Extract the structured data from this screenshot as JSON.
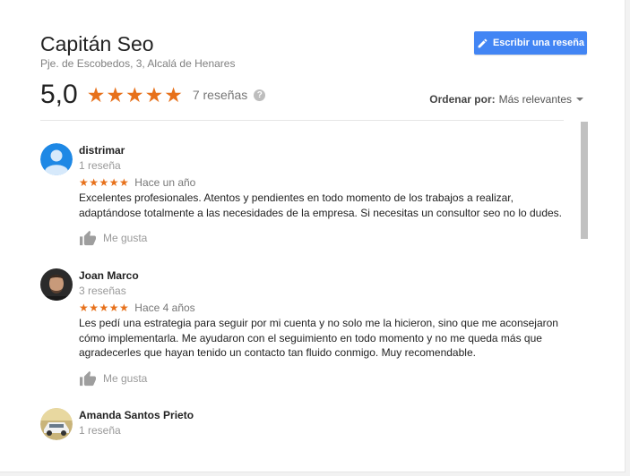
{
  "business": {
    "name": "Capitán Seo",
    "address": "Pje. de Escobedos, 3, Alcalá de Henares"
  },
  "write_review": {
    "label": "Escribir una reseña",
    "icon": "pencil-icon",
    "color": "#4285f4"
  },
  "summary": {
    "rating": "5,0",
    "stars": "★★★★★",
    "count_label": "7 reseñas",
    "help_icon": "?"
  },
  "sort": {
    "label": "Ordenar por:",
    "value": "Más relevantes"
  },
  "colors": {
    "star": "#e7711b",
    "accent": "#4285f4"
  },
  "reviews": [
    {
      "name": "distrimar",
      "meta": "1 reseña",
      "stars": "★★★★★",
      "rating": 5,
      "date": "Hace un año",
      "text": "Excelentes profesionales. Atentos y pendientes en todo momento de los trabajos a realizar, adaptándose totalmente a las necesidades de la empresa. Si necesitas un consultor seo no lo dudes.",
      "like_label": "Me gusta"
    },
    {
      "name": "Joan Marco",
      "meta": "3 reseñas",
      "stars": "★★★★★",
      "rating": 5,
      "date": "Hace 4 años",
      "text": "Les pedí una estrategia para seguir por mi cuenta y no solo me la hicieron, sino que me aconsejaron cómo implementarla. Me ayudaron con el seguimiento en todo momento y no me queda más que agradecerles que hayan tenido un contacto tan fluido conmigo. Muy recomendable.",
      "like_label": "Me gusta"
    },
    {
      "name": "Amanda Santos Prieto",
      "meta": "1 reseña"
    }
  ]
}
